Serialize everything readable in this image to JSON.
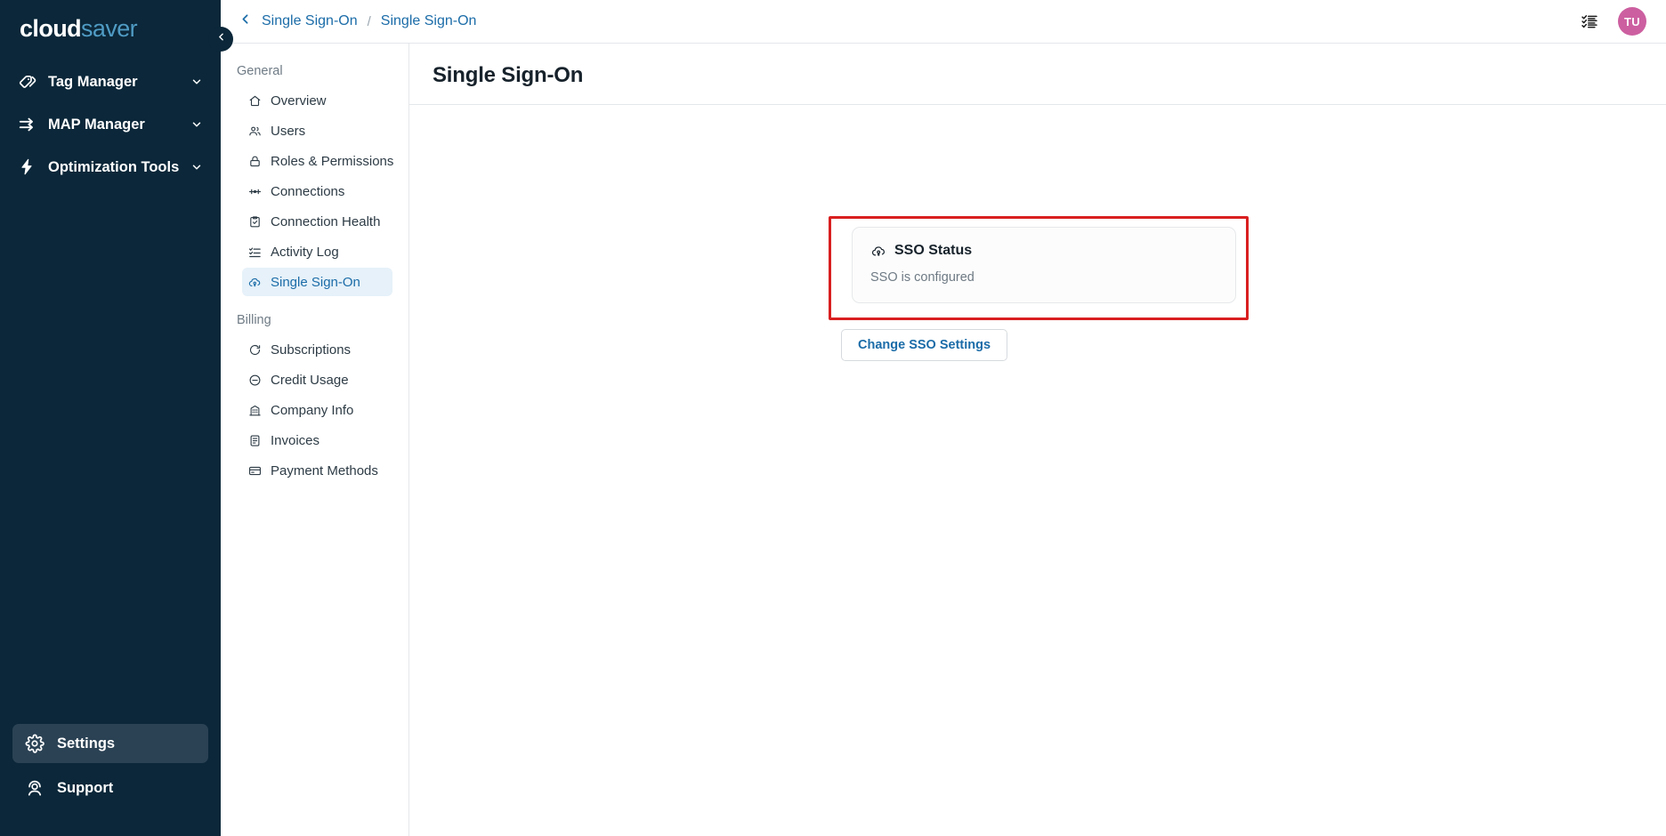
{
  "brand": {
    "part1": "cloud",
    "part2": "saver"
  },
  "rail": {
    "items": [
      {
        "label": "Tag Manager",
        "icon": "tags-icon",
        "chevron": "chevron-down-icon"
      },
      {
        "label": "MAP Manager",
        "icon": "arrows-right-icon",
        "chevron": "chevron-down-icon"
      },
      {
        "label": "Optimization Tools",
        "icon": "lightning-bolt-icon",
        "chevron": "chevron-down-icon"
      }
    ],
    "bottom": [
      {
        "label": "Settings",
        "icon": "gear-icon",
        "active": true
      },
      {
        "label": "Support",
        "icon": "headset-agent-icon",
        "active": false
      }
    ],
    "collapse_tooltip": "Collapse sidebar"
  },
  "topbar": {
    "back_icon": "chevron-left-icon",
    "breadcrumb": [
      "Single Sign-On",
      "Single Sign-On"
    ],
    "separator": "/",
    "checklist_icon": "checklist-icon",
    "avatar_initials": "TU",
    "avatar_color": "#cc5fa0"
  },
  "subnav": {
    "groups": [
      {
        "label": "General",
        "items": [
          {
            "label": "Overview",
            "icon": "home-icon",
            "active": false
          },
          {
            "label": "Users",
            "icon": "users-icon",
            "active": false
          },
          {
            "label": "Roles & Permissions",
            "icon": "lock-icon",
            "active": false
          },
          {
            "label": "Connections",
            "icon": "connections-icon",
            "active": false
          },
          {
            "label": "Connection Health",
            "icon": "clipboard-check-icon",
            "active": false
          },
          {
            "label": "Activity Log",
            "icon": "list-checks-icon",
            "active": false
          },
          {
            "label": "Single Sign-On",
            "icon": "cloud-key-icon",
            "active": true
          }
        ]
      },
      {
        "label": "Billing",
        "items": [
          {
            "label": "Subscriptions",
            "icon": "refresh-circle-icon",
            "active": false
          },
          {
            "label": "Credit Usage",
            "icon": "minus-circle-icon",
            "active": false
          },
          {
            "label": "Company Info",
            "icon": "building-icon",
            "active": false
          },
          {
            "label": "Invoices",
            "icon": "invoice-document-icon",
            "active": false
          },
          {
            "label": "Payment Methods",
            "icon": "credit-card-icon",
            "active": false
          }
        ]
      }
    ]
  },
  "main": {
    "page_title": "Single Sign-On",
    "card": {
      "icon": "cloud-key-icon",
      "title": "SSO Status",
      "status_text": "SSO is configured"
    },
    "change_button_label": "Change SSO Settings",
    "annotation_color": "#d91f20"
  }
}
